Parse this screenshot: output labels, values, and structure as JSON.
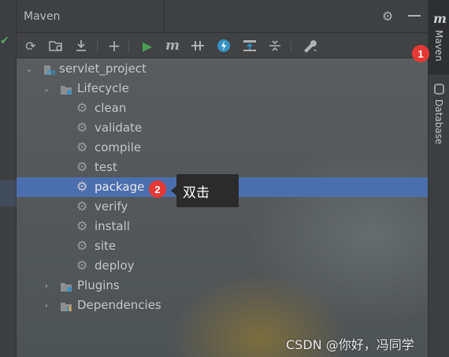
{
  "panel": {
    "title": "Maven"
  },
  "toolbar": {
    "buttons": [
      {
        "icon": "reload-icon",
        "glyph": "⟳"
      },
      {
        "icon": "generate-sources-icon",
        "glyph": "▤"
      },
      {
        "icon": "download-icon",
        "glyph": "⤓"
      },
      {
        "icon": "add-icon",
        "glyph": "+"
      },
      {
        "icon": "run-icon",
        "glyph": "▶"
      },
      {
        "icon": "execute-goal-icon",
        "glyph": "m"
      },
      {
        "icon": "toggle-offline-icon",
        "glyph": "⫲"
      },
      {
        "icon": "skip-tests-icon",
        "glyph": "ϟ"
      },
      {
        "icon": "show-dependencies-icon",
        "glyph": "⊤"
      },
      {
        "icon": "collapse-all-icon",
        "glyph": "⇟"
      },
      {
        "icon": "settings-wrench-icon",
        "glyph": "🔧"
      }
    ]
  },
  "tree": {
    "project": "servlet_project",
    "lifecycle": "Lifecycle",
    "goals": [
      "clean",
      "validate",
      "compile",
      "test",
      "package",
      "verify",
      "install",
      "site",
      "deploy"
    ],
    "selected": "package",
    "plugins": "Plugins",
    "dependencies": "Dependencies"
  },
  "side_tabs": {
    "maven": "Maven",
    "database": "Database"
  },
  "annotations": {
    "badge1": "1",
    "badge2": "2",
    "tooltip": "双击"
  },
  "watermark": "CSDN @你好，冯同学",
  "colors": {
    "selection": "#4b6eaf",
    "badge": "#e53935",
    "run": "#499c54",
    "accent_blue": "#3592c4"
  }
}
